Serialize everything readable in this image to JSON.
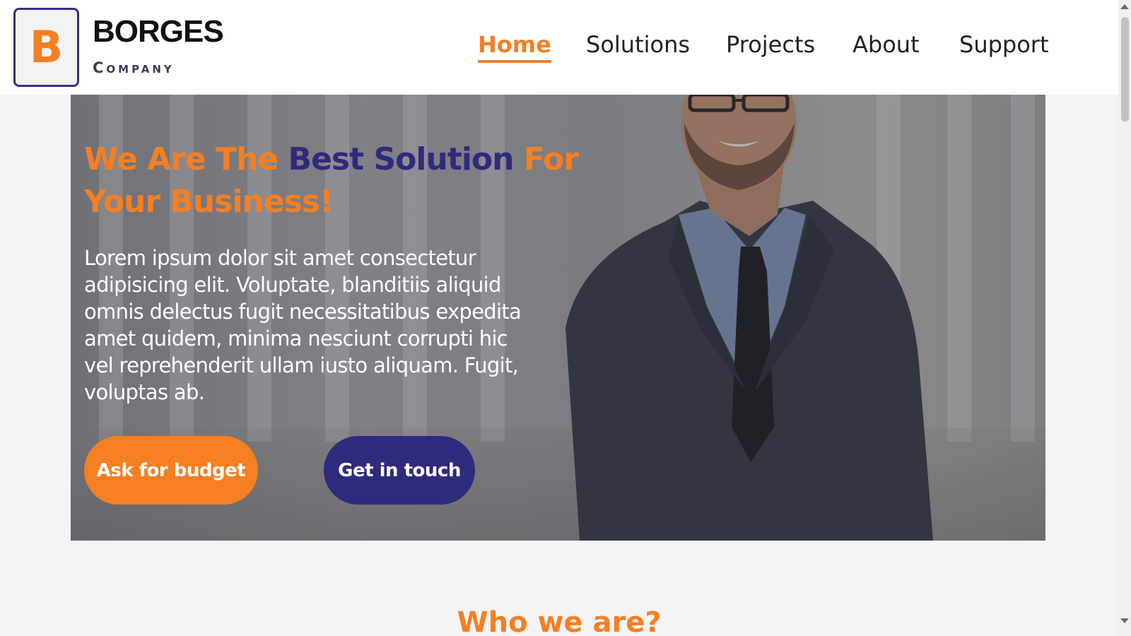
{
  "brand": {
    "logo_letter": "B",
    "name": "BORGES",
    "subtitle": "Company",
    "logo_border_color": "#35307c",
    "accent_color": "#f57f22"
  },
  "nav": {
    "items": [
      {
        "label": "Home",
        "active": true
      },
      {
        "label": "Solutions",
        "active": false
      },
      {
        "label": "Projects",
        "active": false
      },
      {
        "label": "About",
        "active": false
      },
      {
        "label": "Support",
        "active": false
      }
    ]
  },
  "hero": {
    "title_part1": "We Are The ",
    "title_highlight": "Best Solution",
    "title_part2": " For Your Business!",
    "text": "Lorem ipsum dolor sit amet consectetur adipisicing elit. Voluptate, blanditiis aliquid omnis delectus fugit necessitatibus expedita amet quidem, minima nesciunt corrupti hic vel reprehenderit ullam iusto aliquam. Fugit, voluptas ab.",
    "primary_button": "Ask for budget",
    "secondary_button": "Get in touch",
    "highlight_color": "#2e2b7d"
  },
  "section": {
    "title": "Who we are?"
  }
}
